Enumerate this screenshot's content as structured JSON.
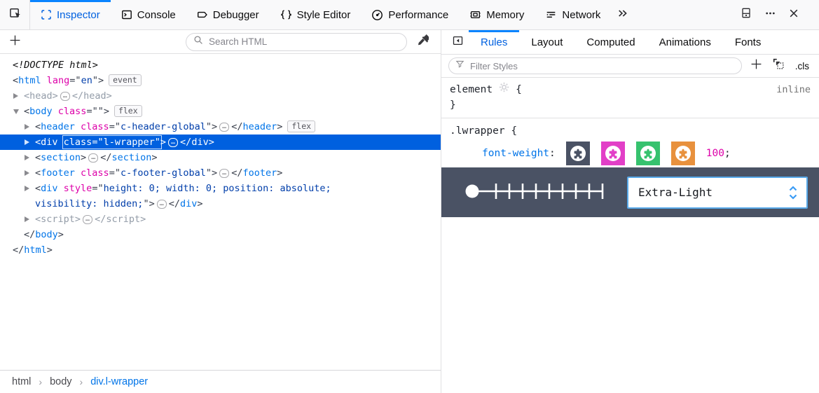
{
  "toolbar": {
    "picker_icon": "pick-element-icon",
    "tabs": [
      {
        "label": "Inspector",
        "icon": "inspector-icon",
        "active": true
      },
      {
        "label": "Console",
        "icon": "console-icon",
        "active": false
      },
      {
        "label": "Debugger",
        "icon": "debugger-icon",
        "active": false
      },
      {
        "label": "Style Editor",
        "icon": "style-editor-icon",
        "active": false
      },
      {
        "label": "Performance",
        "icon": "performance-icon",
        "active": false
      },
      {
        "label": "Memory",
        "icon": "memory-icon",
        "active": false
      },
      {
        "label": "Network",
        "icon": "network-icon",
        "active": false
      }
    ],
    "overflow_icon": "chevron-double-right-icon",
    "window_icons": [
      "dock-bottom-icon",
      "meatball-menu-icon",
      "close-icon"
    ]
  },
  "left": {
    "add_label": "+",
    "search_placeholder": "Search HTML",
    "tree": {
      "rows": [
        {
          "indent": 0,
          "segs": [
            {
              "c": "doctype",
              "t": "<!DOCTYPE html>"
            }
          ]
        },
        {
          "indent": 0,
          "segs": [
            {
              "c": "p",
              "t": "<"
            },
            {
              "c": "tag",
              "t": "html"
            },
            {
              "c": "atn",
              "t": " lang"
            },
            {
              "c": "p",
              "t": "=\""
            },
            {
              "c": "atv",
              "t": "en"
            },
            {
              "c": "p",
              "t": "\">"
            },
            {
              "c": "badge",
              "t": "event"
            }
          ]
        },
        {
          "indent": 1,
          "arrow": "right",
          "segs": [
            {
              "c": "cm",
              "t": "<head>"
            },
            {
              "c": "dots",
              "t": "…"
            },
            {
              "c": "cm",
              "t": "</head>"
            }
          ]
        },
        {
          "indent": 1,
          "arrow": "down",
          "segs": [
            {
              "c": "p",
              "t": "<"
            },
            {
              "c": "tag",
              "t": "body"
            },
            {
              "c": "atn",
              "t": " class"
            },
            {
              "c": "p",
              "t": "=\"\">"
            },
            {
              "c": "badge",
              "t": "flex"
            }
          ]
        },
        {
          "indent": 2,
          "arrow": "right",
          "segs": [
            {
              "c": "p",
              "t": "<"
            },
            {
              "c": "tag",
              "t": "header"
            },
            {
              "c": "atn",
              "t": " class"
            },
            {
              "c": "p",
              "t": "=\""
            },
            {
              "c": "atv",
              "t": "c-header-global"
            },
            {
              "c": "p",
              "t": "\">"
            },
            {
              "c": "dots",
              "t": "…"
            },
            {
              "c": "p",
              "t": "</"
            },
            {
              "c": "tag",
              "t": "header"
            },
            {
              "c": "p",
              "t": ">"
            },
            {
              "c": "badge",
              "t": "flex"
            }
          ]
        },
        {
          "indent": 2,
          "arrow": "right",
          "selected": true,
          "segs": [
            {
              "c": "p",
              "t": "<"
            },
            {
              "c": "tag",
              "t": "div"
            },
            {
              "c": "p",
              "t": " "
            },
            {
              "box": [
                {
                  "c": "atn",
                  "t": "class"
                },
                {
                  "c": "p",
                  "t": "=\""
                },
                {
                  "c": "atv",
                  "t": "l-wrapper"
                },
                {
                  "c": "p",
                  "t": "\""
                }
              ]
            },
            {
              "c": "p",
              "t": ">"
            },
            {
              "c": "dots",
              "t": "…"
            },
            {
              "c": "p",
              "t": "</"
            },
            {
              "c": "tag",
              "t": "div"
            },
            {
              "c": "p",
              "t": ">"
            }
          ]
        },
        {
          "indent": 2,
          "arrow": "right",
          "segs": [
            {
              "c": "p",
              "t": "<"
            },
            {
              "c": "tag",
              "t": "section"
            },
            {
              "c": "p",
              "t": ">"
            },
            {
              "c": "dots",
              "t": "…"
            },
            {
              "c": "p",
              "t": "</"
            },
            {
              "c": "tag",
              "t": "section"
            },
            {
              "c": "p",
              "t": ">"
            }
          ]
        },
        {
          "indent": 2,
          "arrow": "right",
          "segs": [
            {
              "c": "p",
              "t": "<"
            },
            {
              "c": "tag",
              "t": "footer"
            },
            {
              "c": "atn",
              "t": " class"
            },
            {
              "c": "p",
              "t": "=\""
            },
            {
              "c": "atv",
              "t": "c-footer-global"
            },
            {
              "c": "p",
              "t": "\">"
            },
            {
              "c": "dots",
              "t": "…"
            },
            {
              "c": "p",
              "t": "</"
            },
            {
              "c": "tag",
              "t": "footer"
            },
            {
              "c": "p",
              "t": ">"
            }
          ]
        },
        {
          "indent": 2,
          "arrow": "right",
          "segs": [
            {
              "c": "p",
              "t": "<"
            },
            {
              "c": "tag",
              "t": "div"
            },
            {
              "c": "atn",
              "t": " style"
            },
            {
              "c": "p",
              "t": "=\""
            },
            {
              "c": "atv",
              "t": "height: 0; width: 0; position: absolute;"
            }
          ]
        },
        {
          "indent": 2,
          "segs": [
            {
              "c": "atv",
              "t": "visibility: hidden;"
            },
            {
              "c": "p",
              "t": "\">"
            },
            {
              "c": "dots",
              "t": "…"
            },
            {
              "c": "p",
              "t": "</"
            },
            {
              "c": "tag",
              "t": "div"
            },
            {
              "c": "p",
              "t": ">"
            }
          ]
        },
        {
          "indent": 2,
          "arrow": "right",
          "segs": [
            {
              "c": "cm",
              "t": "<script>"
            },
            {
              "c": "dots",
              "t": "…"
            },
            {
              "c": "cm",
              "t": "</script>"
            }
          ]
        },
        {
          "indent": 1,
          "segs": [
            {
              "c": "p",
              "t": "</"
            },
            {
              "c": "tag",
              "t": "body"
            },
            {
              "c": "p",
              "t": ">"
            }
          ]
        },
        {
          "indent": 0,
          "segs": [
            {
              "c": "p",
              "t": "</"
            },
            {
              "c": "tag",
              "t": "html"
            },
            {
              "c": "p",
              "t": ">"
            }
          ]
        }
      ]
    },
    "breadcrumbs": [
      {
        "label": "html",
        "active": false
      },
      {
        "label": "body",
        "active": false
      },
      {
        "label": "div.l-wrapper",
        "active": true
      }
    ]
  },
  "right": {
    "tabs": [
      {
        "label": "Rules",
        "active": true
      },
      {
        "label": "Layout",
        "active": false
      },
      {
        "label": "Computed",
        "active": false
      },
      {
        "label": "Animations",
        "active": false
      },
      {
        "label": "Fonts",
        "active": false
      }
    ],
    "filter_placeholder": "Filter Styles",
    "add_rule_label": "+",
    "cls_label": ".cls",
    "element_rule": {
      "selector": "element",
      "brace_open": "{",
      "brace_close": "}",
      "source": "inline"
    },
    "lwrapper_rule": {
      "selector": ".lwrapper",
      "brace_open": "{",
      "property": "font-weight",
      "colon": ":",
      "value": "100",
      "semicolon": ";",
      "swatches": [
        {
          "name": "slate-extension-swatch",
          "color": "#4a5264"
        },
        {
          "name": "magenta-extension-swatch",
          "color": "#e23fc7"
        },
        {
          "name": "green-extension-swatch",
          "color": "#36c26e"
        },
        {
          "name": "orange-extension-swatch",
          "color": "#e8913d"
        }
      ]
    },
    "font_widget": {
      "value": "Extra-Light",
      "slider_position": "min"
    }
  },
  "colors": {
    "accent_blue": "#0a84ff",
    "tag_blue": "#0074e8",
    "attr_magenta": "#dd00a9",
    "value_navy": "#003eaa",
    "selection_blue": "#0060df",
    "widget_panel": "#4a5264",
    "dropdown_border": "#58a9e9"
  }
}
